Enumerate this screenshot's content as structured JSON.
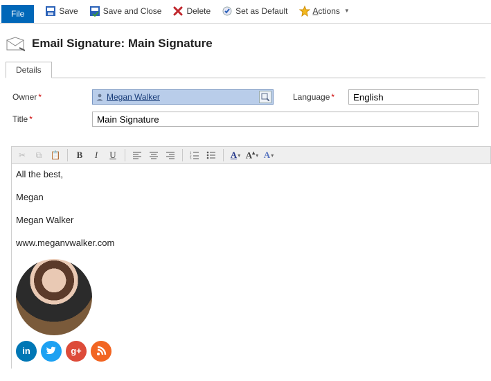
{
  "toolbar": {
    "file_label": "File",
    "save_label": "Save",
    "save_close_label": "Save and Close",
    "delete_label": "Delete",
    "set_default_label": "Set as Default",
    "actions_label": "Actions"
  },
  "header": {
    "title": "Email Signature: Main Signature"
  },
  "tabs": {
    "details": "Details"
  },
  "form": {
    "owner_label": "Owner",
    "owner_value": "Megan Walker",
    "language_label": "Language",
    "language_value": "English",
    "title_label": "Title",
    "title_value": "Main Signature"
  },
  "editor": {
    "line1": "All the best,",
    "line2": "Megan",
    "line3": "Megan Walker",
    "line4": "www.meganvwalker.com"
  },
  "social": {
    "linkedin": "in",
    "twitter": "",
    "gplus": "g+",
    "rss": ""
  }
}
